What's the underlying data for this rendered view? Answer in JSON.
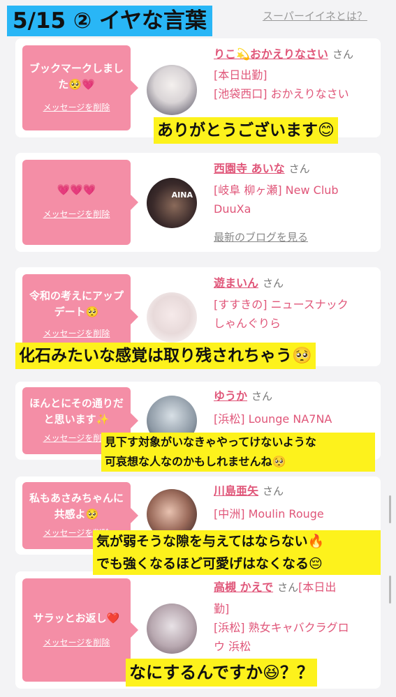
{
  "header": {
    "title": "5/15 ② イヤな言葉",
    "super_link": "スーパーイイネとは？"
  },
  "delete_label": "メッセージを削除",
  "blog_label": "最新のブログを見る",
  "san_label": "さん",
  "cards": [
    {
      "message": "ブックマークしました🥺💗",
      "name": "りこ💫おかえりなさい",
      "shop1": "[本日出勤]",
      "shop2": "[池袋西口] おかえりなさい"
    },
    {
      "message": "💗💗💗",
      "name": "西園寺 あいな",
      "shop1": "[岐阜 柳ヶ瀬] New Club",
      "shop2": "DuuXa",
      "avatar_text": "AINA"
    },
    {
      "message": "令和の考えにアップデート🥺",
      "name": "遊まいん",
      "shop1": "[すすきの] ニュースナック",
      "shop2": "しゃんぐりら"
    },
    {
      "message": "ほんとにその通りだと思います✨",
      "name": "ゆうか",
      "shop1": "[浜松] Lounge NA7NA"
    },
    {
      "message": "私もあさみちゃんに共感よ🥺",
      "name": "川島亜矢",
      "shop1": "[中洲] Moulin Rouge"
    },
    {
      "message": "サラッとお返し❤️",
      "name": "高槻 かえで",
      "shop1": "[本日出",
      "shop2": "勤]",
      "shop3": "[浜松] 熟女キャバクラグロ",
      "shop4": "ウ 浜松"
    }
  ],
  "captions": {
    "c1": "ありがとうございます😊",
    "c2": "化石みたいな感覚は取り残されちゃう🥺",
    "c3a": "見下す対象がいなきゃやってけないような",
    "c3b": "可哀想な人なのかもしれませんね🥺",
    "c4a": "気が弱そうな隙を与えてはならない🔥",
    "c4b": "でも強くなるほど可愛げはなくなる😔",
    "c5": "なにするんですか😆？？"
  },
  "colors": {
    "accent_pink": "#f48ea6",
    "name_pink": "#e05679",
    "highlight": "#fdf21c",
    "title_badge": "#29b6f6"
  }
}
